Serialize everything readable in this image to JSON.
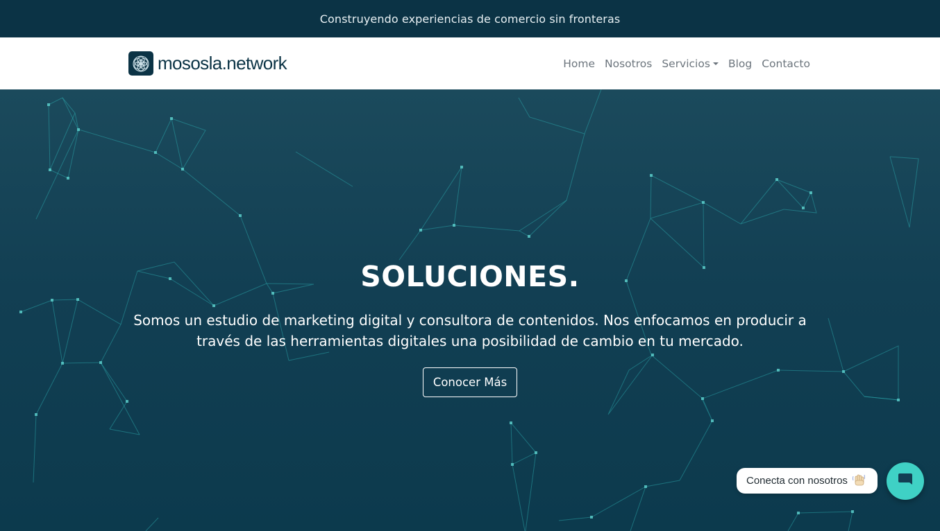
{
  "topbar": {
    "text": "Construyendo experiencias de comercio sin fronteras"
  },
  "brand": {
    "name": "mososla.network",
    "logo_icon": "flower-of-life-icon"
  },
  "nav": {
    "items": [
      {
        "label": "Home"
      },
      {
        "label": "Nosotros"
      },
      {
        "label": "Servicios",
        "dropdown": true
      },
      {
        "label": "Blog"
      },
      {
        "label": "Contacto"
      }
    ]
  },
  "hero": {
    "title": "SOLUCIONES.",
    "description": "Somos un estudio de marketing digital y consultora de contenidos. Nos enfocamos en producir a través de las herramientas digitales una posibilidad de cambio en tu mercado.",
    "button_label": "Conocer Más"
  },
  "chat": {
    "bubble_text": "Conecta con nosotros",
    "bubble_icon": "waving-hand-icon",
    "button_icon": "chat-icon",
    "accent": "#3fd1c5"
  },
  "colors": {
    "topbar_bg": "#0b3345",
    "hero_bg": "#123f53",
    "network_lines": "#2fb3b5",
    "nav_text": "#6c757d"
  }
}
